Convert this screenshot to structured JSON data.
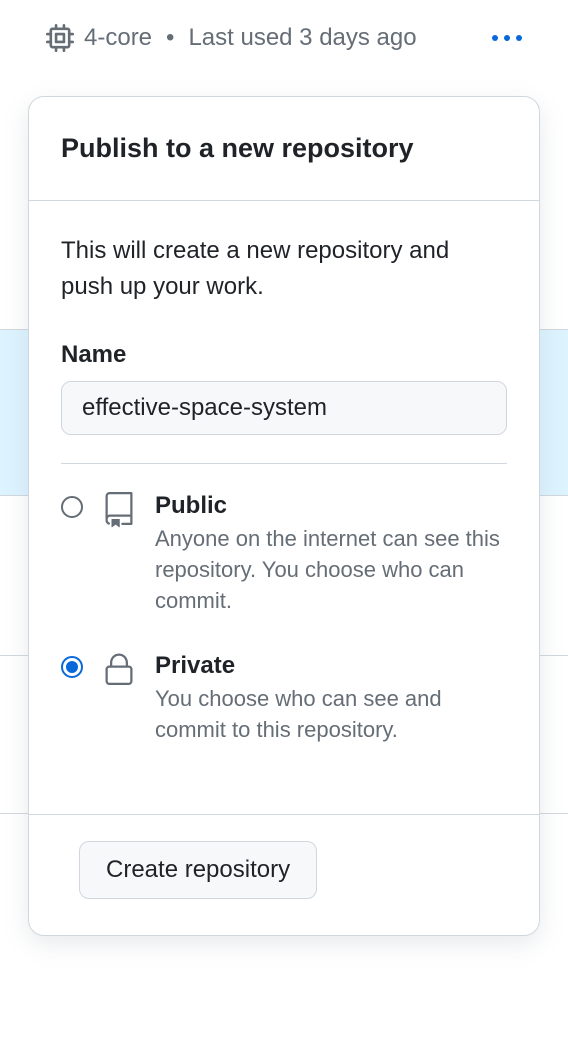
{
  "header": {
    "cores": "4-core",
    "last_used": "Last used 3 days ago"
  },
  "dialog": {
    "title": "Publish to a new repository",
    "description": "This will create a new repository and push up your work.",
    "name_label": "Name",
    "name_value": "effective-space-system",
    "visibility": {
      "public": {
        "title": "Public",
        "desc": "Anyone on the internet can see this repository. You choose who can commit."
      },
      "private": {
        "title": "Private",
        "desc": "You choose who can see and commit to this repository."
      },
      "selected": "private"
    },
    "create_button": "Create repository"
  }
}
